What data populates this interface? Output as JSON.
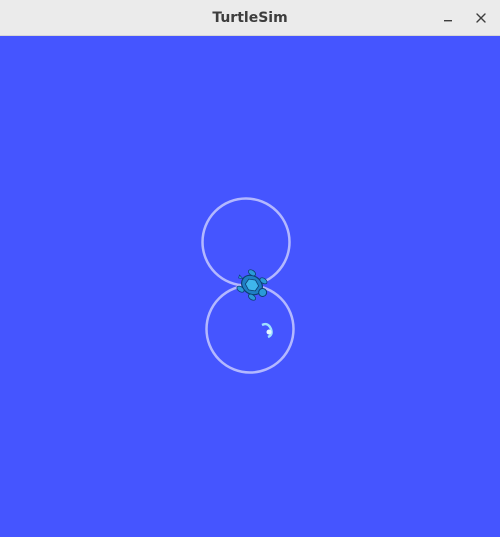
{
  "window": {
    "title": "TurtleSim",
    "controls": [
      {
        "name": "minimize",
        "icon": "minimize-icon"
      },
      {
        "name": "close",
        "icon": "close-icon"
      }
    ]
  },
  "canvas": {
    "background_color": "#4555ff",
    "pen_color": "#b3b8ff",
    "turtle_color": "#1a8fd1"
  }
}
